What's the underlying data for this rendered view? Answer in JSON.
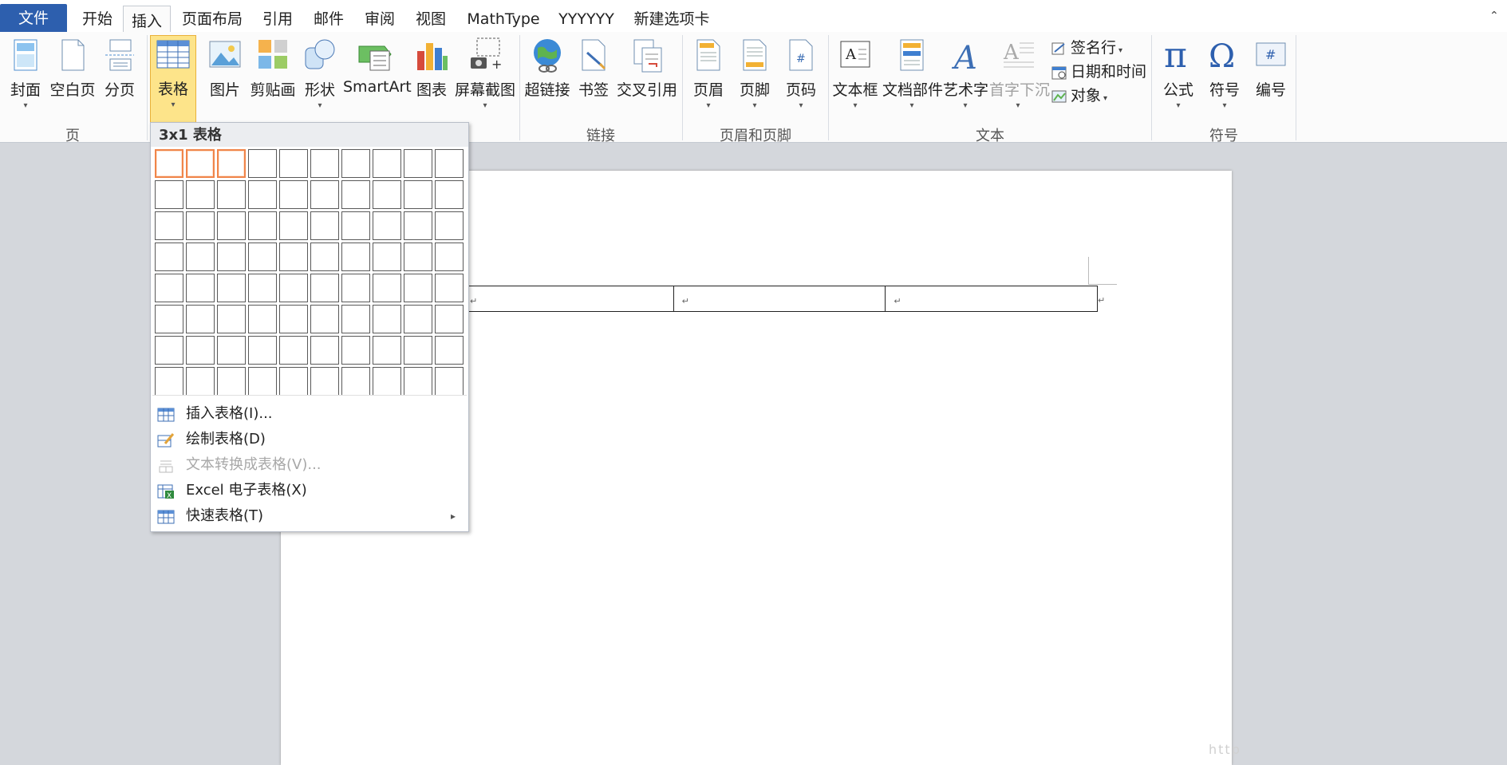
{
  "tabs": [
    {
      "label": "文件"
    },
    {
      "label": "开始"
    },
    {
      "label": "插入"
    },
    {
      "label": "页面布局"
    },
    {
      "label": "引用"
    },
    {
      "label": "邮件"
    },
    {
      "label": "审阅"
    },
    {
      "label": "视图"
    },
    {
      "label": "MathType"
    },
    {
      "label": "YYYYYY"
    },
    {
      "label": "新建选项卡"
    }
  ],
  "ribbon": {
    "page_group": {
      "label": "页",
      "cover": "封面",
      "blank": "空白页",
      "break": "分页"
    },
    "table_group": {
      "table": "表格"
    },
    "illustrations": {
      "picture": "图片",
      "clipart": "剪贴画",
      "shapes": "形状",
      "smartart": "SmartArt",
      "chart": "图表",
      "screenshot": "屏幕截图"
    },
    "links_group": {
      "label": "链接",
      "hyperlink": "超链接",
      "bookmark": "书签",
      "crossref": "交叉引用"
    },
    "header_footer_group": {
      "label": "页眉和页脚",
      "header": "页眉",
      "footer": "页脚",
      "page_number": "页码"
    },
    "text_group": {
      "label": "文本",
      "textbox": "文本框",
      "quickparts": "文档部件",
      "wordart": "艺术字",
      "dropcap": "首字下沉",
      "signature": "签名行",
      "datetime": "日期和时间",
      "object": "对象"
    },
    "symbols_group": {
      "label": "符号",
      "equation": "公式",
      "symbol": "符号",
      "number": "编号"
    }
  },
  "dropdown": {
    "header": "3x1 表格",
    "grid_rows": 8,
    "grid_cols": 10,
    "highlight_rows": 1,
    "highlight_cols": 3,
    "items": [
      {
        "label": "插入表格(I)...",
        "enabled": true
      },
      {
        "label": "绘制表格(D)",
        "enabled": true
      },
      {
        "label": "文本转换成表格(V)...",
        "enabled": false
      },
      {
        "label": "Excel 电子表格(X)",
        "enabled": true
      },
      {
        "label": "快速表格(T)",
        "enabled": true,
        "submenu_arrow": "▸"
      }
    ]
  },
  "document": {
    "table_cells": 3,
    "cell_mark": "↵"
  },
  "watermark": "http",
  "colors": {
    "file_tab": "#2d5fae",
    "selected_button": "#fde48a",
    "grid_highlight": "#f0854a"
  }
}
